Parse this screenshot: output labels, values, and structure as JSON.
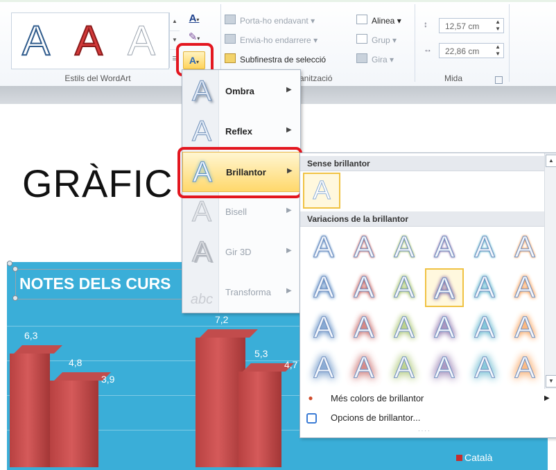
{
  "ribbon": {
    "wordart_styles": {
      "samples": [
        "A",
        "A",
        "A"
      ],
      "group_label": "Estils del WordArt"
    },
    "text_format": {
      "fill_glyph": "A",
      "outline_glyph": "✎",
      "effects_glyph": "A"
    },
    "arrange": {
      "bring_forward": "Porta-ho endavant",
      "send_backward": "Envia-ho endarrere",
      "selection_pane": "Subfinestra de selecció",
      "align": "Alinea",
      "group": "Grup",
      "rotate": "Gira",
      "group_label": "anització"
    },
    "size": {
      "height": "12,57 cm",
      "width": "22,86 cm",
      "group_label": "Mida"
    }
  },
  "document": {
    "title_visible": "GRÀFIC",
    "chart": {
      "title": "NOTES DELS CURS",
      "legend": "Català",
      "series_color": "#c62d2d",
      "background": "#3aaed8"
    }
  },
  "chart_data": {
    "type": "bar",
    "title": "NOTES DELS CURS",
    "series": [
      {
        "name": "Català",
        "values": [
          6.3,
          4.8,
          3.9,
          7.2,
          5.3,
          4.7
        ]
      }
    ],
    "legend_placement": "right"
  },
  "menu": {
    "items": [
      {
        "label": "Ombra",
        "state": "normal"
      },
      {
        "label": "Reflex",
        "state": "normal"
      },
      {
        "label": "Brillantor",
        "state": "active"
      },
      {
        "label": "Bisell",
        "state": "disabled"
      },
      {
        "label": "Gir 3D",
        "state": "disabled"
      },
      {
        "label": "Transforma",
        "state": "disabled"
      }
    ]
  },
  "glow": {
    "no_glow_header": "Sense brillantor",
    "variations_header": "Variacions de la brillantor",
    "glyph": "A",
    "colors": [
      "#4f81bd",
      "#c0504d",
      "#9bbb59",
      "#8064a2",
      "#4bacc6",
      "#f79646"
    ],
    "rows": 4,
    "selected": {
      "row": 1,
      "col": 3
    },
    "more_colors": "Més colors de brillantor",
    "options": "Opcions de brillantor..."
  }
}
